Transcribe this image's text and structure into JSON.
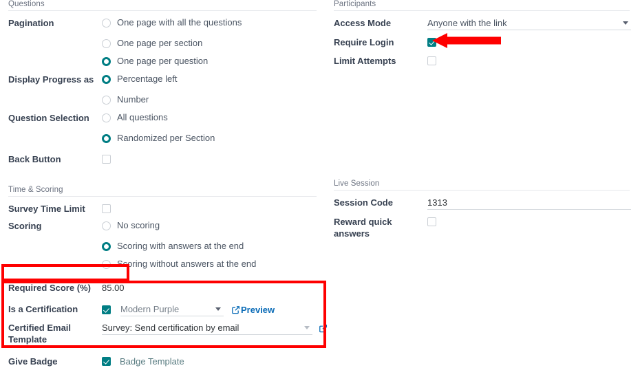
{
  "left_column": {
    "sections": [
      {
        "title": "Questions",
        "fields": [
          {
            "label": "Pagination",
            "type": "radio-group",
            "options": [
              {
                "text": "One page with all the questions",
                "selected": false
              },
              {
                "text": "One page per section",
                "selected": false
              },
              {
                "text": "One page per question",
                "selected": true
              }
            ]
          },
          {
            "label": "Display Progress as",
            "type": "radio-group",
            "options": [
              {
                "text": "Percentage left",
                "selected": true
              },
              {
                "text": "Number",
                "selected": false
              }
            ]
          },
          {
            "label": "Question Selection",
            "type": "radio-group",
            "options": [
              {
                "text": "All questions",
                "selected": false
              },
              {
                "text": "Randomized per Section",
                "selected": true
              }
            ]
          },
          {
            "label": "Back Button",
            "type": "checkbox",
            "checked": false
          }
        ]
      },
      {
        "title": "Time & Scoring",
        "fields": [
          {
            "label": "Survey Time Limit",
            "type": "checkbox",
            "checked": false
          },
          {
            "label": "Scoring",
            "type": "radio-group",
            "options": [
              {
                "text": "No scoring",
                "selected": false
              },
              {
                "text": "Scoring with answers at the end",
                "selected": true
              },
              {
                "text": "Scoring without answers at the end",
                "selected": false
              }
            ]
          },
          {
            "label": "Required Score (%)",
            "type": "text",
            "value": "85.00"
          },
          {
            "label": "Is a Certification",
            "type": "checkbox-dropdown-link",
            "checked": true,
            "dropdown_value": "Modern Purple",
            "link_label": "Preview",
            "link_icon": "external-link-icon"
          },
          {
            "label": "Certified Email Template",
            "type": "dropdown-link",
            "dropdown_value": "Survey: Send certification by email",
            "link_icon": "external-link-icon"
          },
          {
            "label": "Give Badge",
            "type": "checkbox-text",
            "checked": true,
            "text": "Badge Template"
          }
        ]
      }
    ]
  },
  "right_column": {
    "sections": [
      {
        "title": "Participants",
        "fields": [
          {
            "label": "Access Mode",
            "type": "dropdown",
            "value": "Anyone with the link"
          },
          {
            "label": "Require Login",
            "type": "checkbox",
            "checked": true
          },
          {
            "label": "Limit Attempts",
            "type": "checkbox",
            "checked": false
          }
        ]
      },
      {
        "title": "Live Session",
        "fields": [
          {
            "label": "Session Code",
            "type": "dropdown-plain",
            "value": "1313"
          },
          {
            "label": "Reward quick answers",
            "type": "checkbox",
            "checked": false
          }
        ]
      }
    ]
  },
  "annotations": {
    "highlight_color": "#fe0000",
    "arrow_color": "#fe0000",
    "boxes": [
      {
        "name": "required-score-highlight"
      },
      {
        "name": "certification-block-highlight"
      }
    ],
    "arrow": {
      "name": "require-login-arrow",
      "direction": "left"
    }
  },
  "theme": {
    "accent": "#017e84",
    "link": "#0b6cb7",
    "label": "#374151",
    "muted": "#6b7280"
  }
}
